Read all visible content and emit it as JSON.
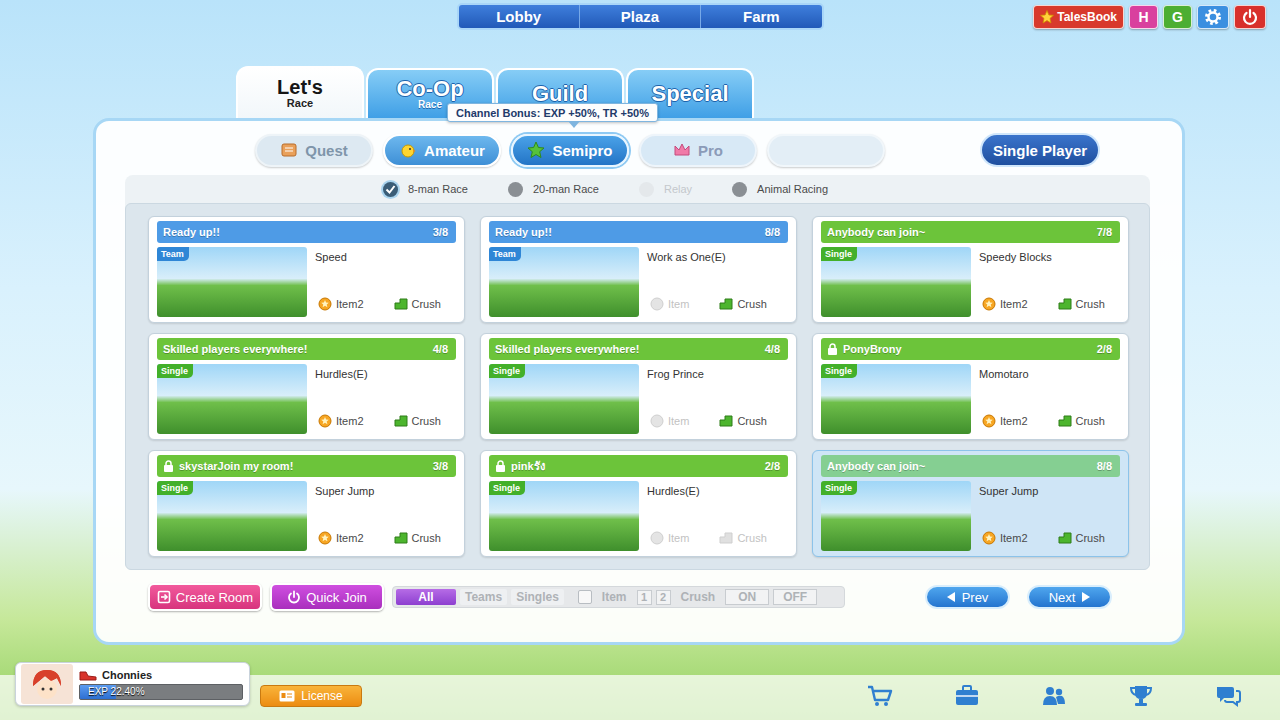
{
  "top_nav": [
    "Lobby",
    "Plaza",
    "Farm"
  ],
  "top_buttons": [
    {
      "label": "TalesBook",
      "color": "#d8392c"
    },
    {
      "label": "H",
      "color": "#d9409e"
    },
    {
      "label": "G",
      "color": "#4cae32"
    }
  ],
  "main_tabs": [
    {
      "label": "Let's",
      "sublabel": "Race",
      "selected": true
    },
    {
      "label": "Co-Op",
      "sublabel": "Race",
      "selected": false
    },
    {
      "label": "Guild",
      "selected": false
    },
    {
      "label": "Special",
      "selected": false
    }
  ],
  "tooltip": "Channel Bonus: EXP +50%, TR +50%",
  "leagues": [
    {
      "label": "Quest",
      "kind": "quest",
      "selected": false,
      "enabled": true
    },
    {
      "label": "Amateur",
      "kind": "league",
      "selected": false,
      "enabled": true
    },
    {
      "label": "Semipro",
      "kind": "league",
      "selected": true,
      "enabled": true
    },
    {
      "label": "Pro",
      "kind": "league",
      "selected": false,
      "enabled": false
    }
  ],
  "single_player": "Single Player",
  "race_types": [
    {
      "label": "8-man Race",
      "checked": true,
      "disabled": false
    },
    {
      "label": "20-man Race",
      "checked": false,
      "disabled": false
    },
    {
      "label": "Relay",
      "checked": false,
      "disabled": true
    },
    {
      "label": "Animal Racing",
      "checked": false,
      "disabled": false
    }
  ],
  "rooms": [
    {
      "title": "Ready up!!",
      "count": "3/8",
      "locked": false,
      "color": "#4e9be6",
      "kind": "team",
      "mode": "Team",
      "map": "Speed",
      "item": "Item2",
      "item_enabled": true,
      "crush": "Crush",
      "crush_enabled": true,
      "selected": false
    },
    {
      "title": "Ready up!!",
      "count": "8/8",
      "locked": false,
      "color": "#4e9be6",
      "kind": "team",
      "mode": "Team",
      "map": "Work as One(E)",
      "item": "Item",
      "item_enabled": false,
      "crush": "Crush",
      "crush_enabled": true,
      "selected": false
    },
    {
      "title": "Anybody can join~",
      "count": "7/8",
      "locked": false,
      "color": "#6cc43a",
      "kind": "single",
      "mode": "Single",
      "map": "Speedy Blocks",
      "item": "Item2",
      "item_enabled": true,
      "crush": "Crush",
      "crush_enabled": true,
      "selected": false
    },
    {
      "title": "Skilled players everywhere!",
      "count": "4/8",
      "locked": false,
      "color": "#6cc43a",
      "kind": "single",
      "mode": "Single",
      "map": "Hurdles(E)",
      "item": "Item2",
      "item_enabled": true,
      "crush": "Crush",
      "crush_enabled": true,
      "selected": false
    },
    {
      "title": "Skilled players everywhere!",
      "count": "4/8",
      "locked": false,
      "color": "#6cc43a",
      "kind": "single",
      "mode": "Single",
      "map": "Frog Prince",
      "item": "Item",
      "item_enabled": false,
      "crush": "Crush",
      "crush_enabled": true,
      "selected": false
    },
    {
      "title": "PonyBrony",
      "count": "2/8",
      "locked": true,
      "color": "#6cc43a",
      "kind": "single",
      "mode": "Single",
      "map": "Momotaro",
      "item": "Item2",
      "item_enabled": true,
      "crush": "Crush",
      "crush_enabled": true,
      "selected": false
    },
    {
      "title": "skystarJoin my room!",
      "count": "3/8",
      "locked": true,
      "color": "#6cc43a",
      "kind": "single",
      "mode": "Single",
      "map": "Super Jump",
      "item": "Item2",
      "item_enabled": true,
      "crush": "Crush",
      "crush_enabled": true,
      "selected": false
    },
    {
      "title": "pinkรัง",
      "count": "2/8",
      "locked": true,
      "color": "#6cc43a",
      "kind": "single",
      "mode": "Single",
      "map": "Hurdles(E)",
      "item": "Item",
      "item_enabled": false,
      "crush": "Crush",
      "crush_enabled": false,
      "selected": false
    },
    {
      "title": "Anybody can join~",
      "count": "8/8",
      "locked": false,
      "color": "#85cf92",
      "kind": "single",
      "mode": "Single",
      "map": "Super Jump",
      "item": "Item2",
      "item_enabled": true,
      "crush": "Crush",
      "crush_enabled": true,
      "selected": true
    }
  ],
  "controls": {
    "create_room": "Create Room",
    "quick_join": "Quick Join",
    "filters": [
      {
        "label": "All",
        "selected": true
      },
      {
        "label": "Teams",
        "selected": false
      },
      {
        "label": "Singles",
        "selected": false
      }
    ],
    "item_filter": {
      "label": "Item",
      "checked": false
    },
    "item_levels": [
      {
        "label": "1",
        "disabled": true
      },
      {
        "label": "2",
        "disabled": true
      }
    ],
    "crush": {
      "label": "Crush",
      "disabled": true
    },
    "crush_options": [
      {
        "label": "ON",
        "selected": false
      },
      {
        "label": "OFF",
        "selected": false
      }
    ],
    "prev": "Prev",
    "next": "Next"
  },
  "player": {
    "name": "Chonnies",
    "exp": "EXP 22.40%",
    "level": 0.224
  },
  "license": "License"
}
